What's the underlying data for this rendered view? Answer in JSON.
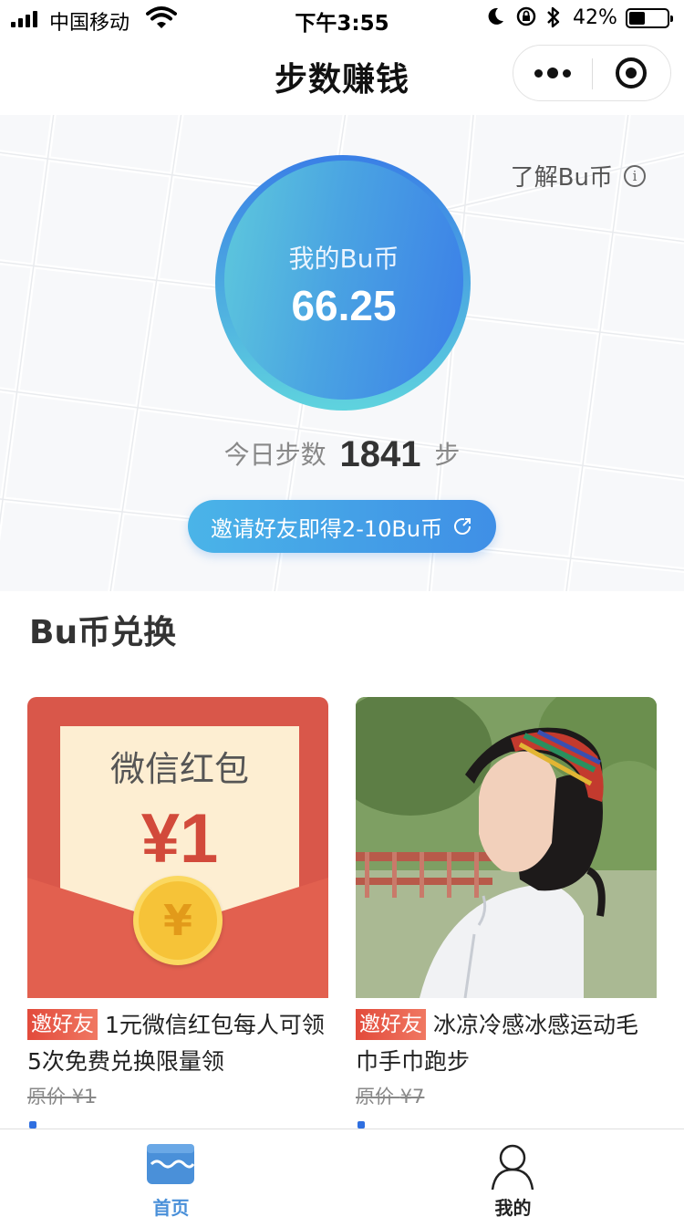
{
  "status_bar": {
    "carrier": "中国移动",
    "time": "下午3:55",
    "battery_percent": "42%",
    "battery_level": 0.42,
    "icons": [
      "signal-icon",
      "wifi-icon",
      "moon-icon",
      "rotation-lock-icon",
      "bluetooth-icon",
      "battery-icon"
    ]
  },
  "nav": {
    "title": "步数赚钱",
    "icons": [
      "more-icon",
      "close-target-icon"
    ]
  },
  "hero": {
    "learn_link": "了解Bu币",
    "info_icon_text": "i",
    "coin_label": "我的Bu币",
    "coin_value": "66.25",
    "steps_prefix": "今日步数",
    "steps_value": "1841",
    "steps_unit": "步",
    "invite_label": "邀请好友即得2-10Bu币"
  },
  "exchange": {
    "title": "Bu币兑换",
    "items": [
      {
        "image_title": "微信红包",
        "image_amount": "¥1",
        "medal_symbol": "¥",
        "tag": "邀好友",
        "description": "1元微信红包每人可领5次免费兑换限量领",
        "orig_label": "原价",
        "orig_price": "¥1"
      },
      {
        "tag": "邀好友",
        "description": "冰凉冷感冰感运动毛巾手巾跑步",
        "orig_label": "原价",
        "orig_price": "¥7"
      }
    ]
  },
  "tabbar": {
    "tabs": [
      {
        "label": "首页",
        "icon": "home-shop-icon",
        "active": true
      },
      {
        "label": "我的",
        "icon": "user-icon",
        "active": false
      }
    ]
  },
  "colors": {
    "accent_blue": "#4a90d9",
    "tag_red": "#e24a3b",
    "coin_gradient_start": "#5ec9dc",
    "coin_gradient_end": "#3b7ee8"
  }
}
